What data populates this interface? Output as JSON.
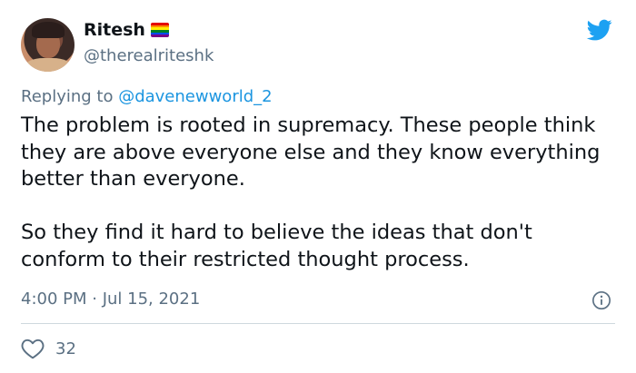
{
  "author": {
    "name": "Ritesh",
    "handle": "@therealriteshk",
    "flag_colors": [
      "#e40303",
      "#ff8c00",
      "#ffed00",
      "#008026",
      "#004dff",
      "#750787"
    ]
  },
  "reply": {
    "prefix": "Replying to ",
    "target": "@davenewworld_2"
  },
  "tweet": {
    "paragraph_1": "The problem is rooted in supremacy. These people think they are above everyone else and they know everything better than everyone.",
    "paragraph_2": "So they find it hard to believe the ideas that don't conform to their restricted thought process.",
    "timestamp": "4:00 PM · Jul 15, 2021"
  },
  "engagement": {
    "likes": "32"
  },
  "colors": {
    "twitter_blue": "#1da1f2",
    "link_blue": "#1b95e0",
    "muted": "#5b7083",
    "divider": "#cfd9de"
  },
  "icons": {
    "logo": "twitter-bird-icon",
    "info": "info-icon",
    "like": "heart-icon"
  }
}
